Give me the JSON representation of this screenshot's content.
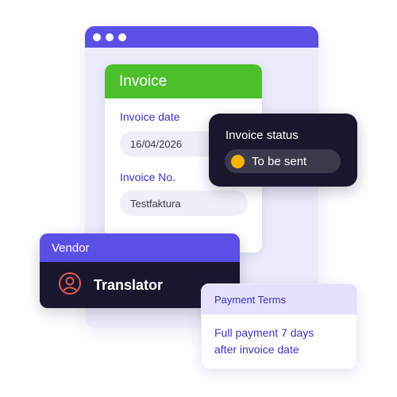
{
  "invoice": {
    "title": "Invoice",
    "date_label": "Invoice date",
    "date_value": "16/04/2026",
    "number_label": "Invoice No.",
    "number_value": "Testfaktura"
  },
  "status": {
    "title": "Invoice status",
    "value": "To be sent",
    "dot_color": "#f7b500"
  },
  "vendor": {
    "title": "Vendor",
    "name": "Translator",
    "icon": "user-icon"
  },
  "payment": {
    "title": "Payment Terms",
    "line1": "Full payment 7 days",
    "line2": "after invoice date"
  },
  "colors": {
    "accent": "#5b4fe6",
    "invoice_green": "#4cbf2b",
    "dark": "#18172e",
    "icon_red": "#e05a4e"
  }
}
